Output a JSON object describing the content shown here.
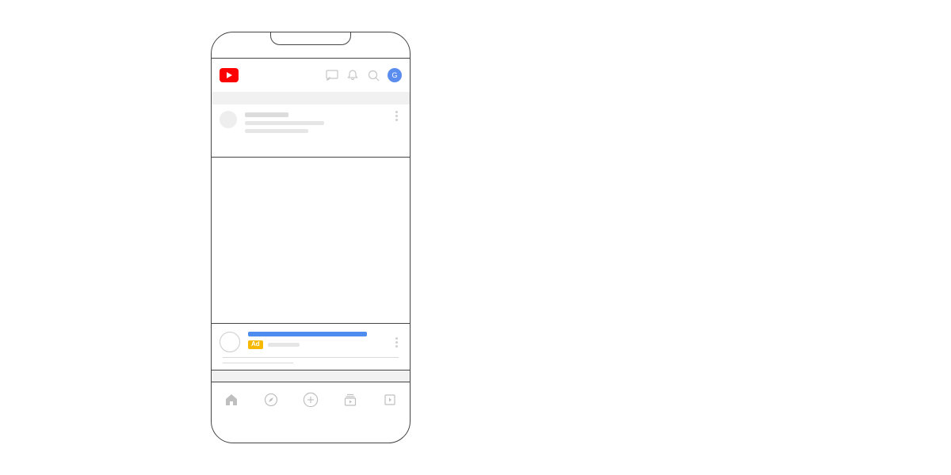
{
  "header": {
    "avatar_letter": "G"
  },
  "ad": {
    "badge_label": "Ad"
  },
  "colors": {
    "brand_red": "#ff0000",
    "accent_blue": "#4f8cf0",
    "ad_yellow": "#f6b800",
    "avatar_blue": "#5b8def"
  }
}
